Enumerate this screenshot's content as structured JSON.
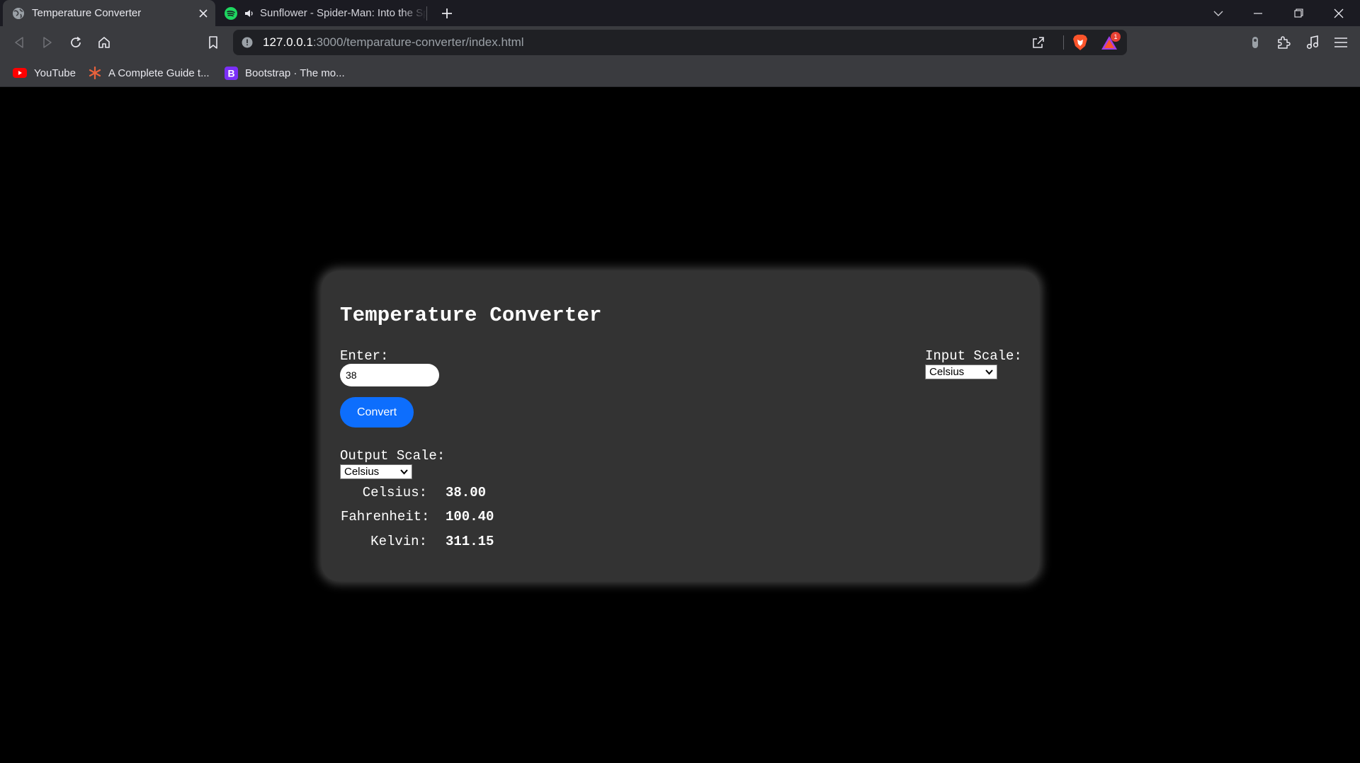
{
  "browser": {
    "tabs": [
      {
        "title": "Temperature Converter",
        "active": true
      },
      {
        "title": "Sunflower - Spider-Man: Into the Spider-Verse",
        "active": false,
        "audio": true
      }
    ],
    "url_host": "127.0.0.1",
    "url_rest": ":3000/temparature-converter/index.html",
    "rewards_badge": "1",
    "bookmarks": [
      {
        "label": "YouTube",
        "icon": "youtube-icon"
      },
      {
        "label": "A Complete Guide t...",
        "icon": "asterisk-icon"
      },
      {
        "label": "Bootstrap · The mo...",
        "icon": "bootstrap-icon"
      }
    ]
  },
  "app": {
    "title": "Temperature Converter",
    "enter_label": "Enter:",
    "input_value": "38",
    "convert_label": "Convert",
    "input_scale_label": "Input Scale:",
    "input_scale_value": "Celsius",
    "output_scale_label": "Output Scale:",
    "output_scale_value": "Celsius",
    "results": [
      {
        "label": "Celsius:",
        "value": "38.00"
      },
      {
        "label": "Fahrenheit:",
        "value": "100.40"
      },
      {
        "label": "Kelvin:",
        "value": "311.15"
      }
    ]
  },
  "colors": {
    "convert_button": "#0d6efd",
    "card_bg": "#333333",
    "page_bg": "#000000"
  }
}
